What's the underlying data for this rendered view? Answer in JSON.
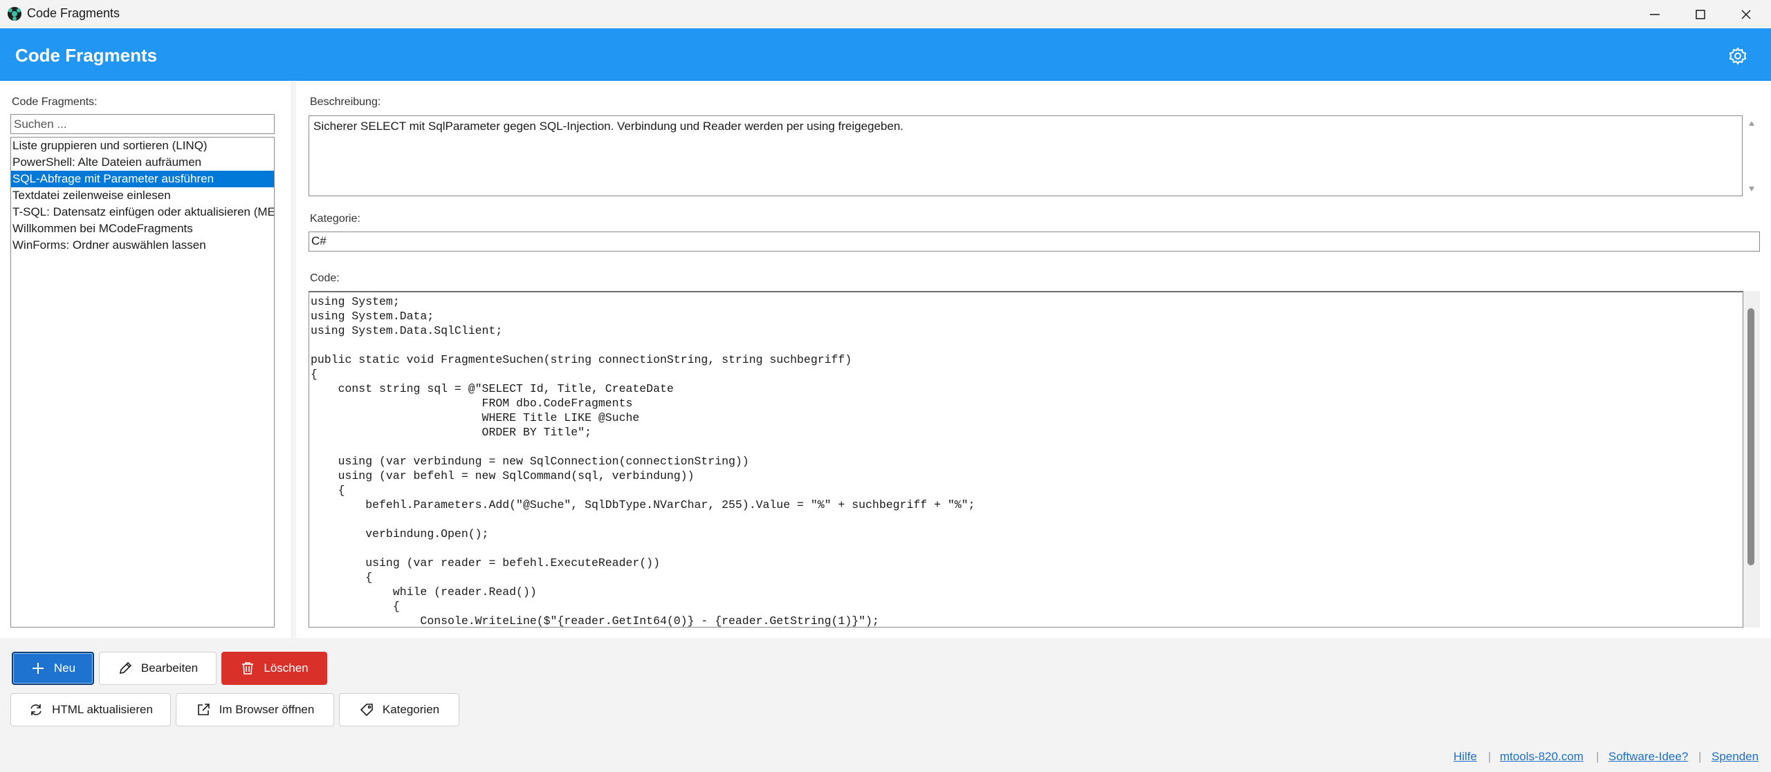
{
  "window": {
    "title": "Code Fragments"
  },
  "header": {
    "title": "Code Fragments"
  },
  "left": {
    "label": "Code Fragments:",
    "search_placeholder": "Suchen ...",
    "items": [
      "Liste gruppieren und sortieren (LINQ)",
      "PowerShell: Alte Dateien aufräumen",
      "SQL-Abfrage mit Parameter ausführen",
      "Textdatei zeilenweise einlesen",
      "T-SQL: Datensatz einfügen oder aktualisieren (MERGE)",
      "Willkommen bei MCodeFragments",
      "WinForms: Ordner auswählen lassen"
    ],
    "selected_index": 2
  },
  "detail": {
    "description_label": "Beschreibung:",
    "description": "Sicherer SELECT mit SqlParameter gegen SQL-Injection. Verbindung und Reader werden per using freigegeben.",
    "category_label": "Kategorie:",
    "category": "C#",
    "code_label": "Code:",
    "code_lines": [
      "using System;",
      "using System.Data;",
      "using System.Data.SqlClient;",
      "",
      "public static void FragmenteSuchen(string connectionString, string suchbegriff)",
      "{",
      "    const string sql = @\"SELECT Id, Title, CreateDate",
      "                         FROM dbo.CodeFragments",
      "                         WHERE Title LIKE @Suche",
      "                         ORDER BY Title\";",
      "",
      "    using (var verbindung = new SqlConnection(connectionString))",
      "    using (var befehl = new SqlCommand(sql, verbindung))",
      "    {",
      "        befehl.Parameters.Add(\"@Suche\", SqlDbType.NVarChar, 255).Value = \"%\" + suchbegriff + \"%\";",
      "",
      "        verbindung.Open();",
      "",
      "        using (var reader = befehl.ExecuteReader())",
      "        {",
      "            while (reader.Read())",
      "            {",
      "                Console.WriteLine($\"{reader.GetInt64(0)} - {reader.GetString(1)}\");"
    ]
  },
  "buttons": {
    "new": "Neu",
    "edit": "Bearbeiten",
    "delete": "Löschen",
    "refresh_html": "HTML aktualisieren",
    "open_browser": "Im Browser öffnen",
    "categories": "Kategorien"
  },
  "footer": {
    "help": "Hilfe",
    "site": "mtools-820.com",
    "idea": "Software-Idee?",
    "donate": "Spenden"
  },
  "colors": {
    "accent": "#2196f3",
    "selection": "#0078d7",
    "primary_button": "#1f73d0",
    "danger_button": "#d9302a",
    "link": "#1f6fc5"
  },
  "icons": {
    "app": "app-logo-icon",
    "settings": "gear-icon",
    "new": "plus-icon",
    "edit": "pencil-icon",
    "delete": "trash-icon",
    "refresh": "refresh-icon",
    "open": "external-link-icon",
    "categories": "tag-icon"
  }
}
